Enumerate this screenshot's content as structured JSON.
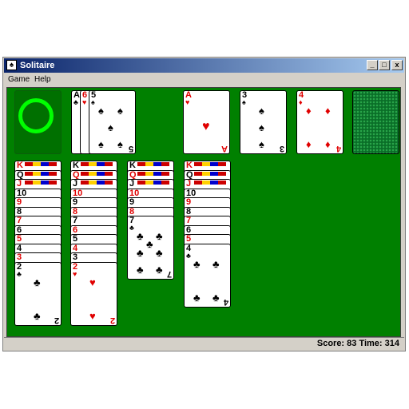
{
  "window": {
    "title": "Solitaire",
    "btn_min": "_",
    "btn_max": "□",
    "btn_close": "x",
    "icon": "card-icon"
  },
  "menu": [
    {
      "label": "Game"
    },
    {
      "label": "Help"
    }
  ],
  "status": {
    "text": "Score: 83 Time: 314"
  },
  "colors": {
    "felt": "#008000",
    "card_red": "#e00000",
    "recycle": "#00ff00"
  },
  "waste": [
    {
      "rank": "A",
      "suit": "♣",
      "color": "black"
    },
    {
      "rank": "6",
      "suit": "♥",
      "color": "red"
    },
    {
      "rank": "5",
      "suit": "♠",
      "color": "black"
    }
  ],
  "foundations": [
    {
      "rank": "A",
      "suit": "♥",
      "color": "red"
    },
    {
      "rank": "3",
      "suit": "♠",
      "color": "black"
    },
    {
      "rank": "4",
      "suit": "♦",
      "color": "red"
    },
    {
      "rank": "",
      "suit": "",
      "color": ""
    }
  ],
  "tableau": [
    {
      "cards": [
        {
          "rank": "K",
          "suit": "♦",
          "color": "red"
        },
        {
          "rank": "Q",
          "suit": "♠",
          "color": "black"
        },
        {
          "rank": "J",
          "suit": "♦",
          "color": "red"
        },
        {
          "rank": "10",
          "suit": "♠",
          "color": "black"
        },
        {
          "rank": "9",
          "suit": "♥",
          "color": "red"
        },
        {
          "rank": "8",
          "suit": "♣",
          "color": "black"
        },
        {
          "rank": "7",
          "suit": "♥",
          "color": "red"
        },
        {
          "rank": "6",
          "suit": "♠",
          "color": "black"
        },
        {
          "rank": "5",
          "suit": "♥",
          "color": "red"
        },
        {
          "rank": "4",
          "suit": "♠",
          "color": "black"
        },
        {
          "rank": "3",
          "suit": "♥",
          "color": "red"
        },
        {
          "rank": "2",
          "suit": "♣",
          "color": "black"
        }
      ]
    },
    {
      "cards": [
        {
          "rank": "K",
          "suit": "♣",
          "color": "black"
        },
        {
          "rank": "Q",
          "suit": "♦",
          "color": "red"
        },
        {
          "rank": "J",
          "suit": "♣",
          "color": "black"
        },
        {
          "rank": "10",
          "suit": "♥",
          "color": "red"
        },
        {
          "rank": "9",
          "suit": "♣",
          "color": "black"
        },
        {
          "rank": "8",
          "suit": "♥",
          "color": "red"
        },
        {
          "rank": "7",
          "suit": "♠",
          "color": "black"
        },
        {
          "rank": "6",
          "suit": "♦",
          "color": "red"
        },
        {
          "rank": "5",
          "suit": "♣",
          "color": "black"
        },
        {
          "rank": "4",
          "suit": "♦",
          "color": "red"
        },
        {
          "rank": "3",
          "suit": "♣",
          "color": "black"
        },
        {
          "rank": "2",
          "suit": "♥",
          "color": "red"
        }
      ]
    },
    {
      "cards": [
        {
          "rank": "K",
          "suit": "♠",
          "color": "black"
        },
        {
          "rank": "Q",
          "suit": "♥",
          "color": "red"
        },
        {
          "rank": "J",
          "suit": "♠",
          "color": "black"
        },
        {
          "rank": "10",
          "suit": "♦",
          "color": "red"
        },
        {
          "rank": "9",
          "suit": "♠",
          "color": "black"
        },
        {
          "rank": "8",
          "suit": "♦",
          "color": "red"
        },
        {
          "rank": "7",
          "suit": "♣",
          "color": "black"
        }
      ]
    },
    {
      "cards": [
        {
          "rank": "K",
          "suit": "♥",
          "color": "red"
        },
        {
          "rank": "Q",
          "suit": "♣",
          "color": "black"
        },
        {
          "rank": "J",
          "suit": "♥",
          "color": "red"
        },
        {
          "rank": "10",
          "suit": "♣",
          "color": "black"
        },
        {
          "rank": "9",
          "suit": "♦",
          "color": "red"
        },
        {
          "rank": "8",
          "suit": "♠",
          "color": "black"
        },
        {
          "rank": "7",
          "suit": "♦",
          "color": "red"
        },
        {
          "rank": "6",
          "suit": "♣",
          "color": "black"
        },
        {
          "rank": "5",
          "suit": "♦",
          "color": "red"
        },
        {
          "rank": "4",
          "suit": "♣",
          "color": "black"
        }
      ]
    }
  ]
}
